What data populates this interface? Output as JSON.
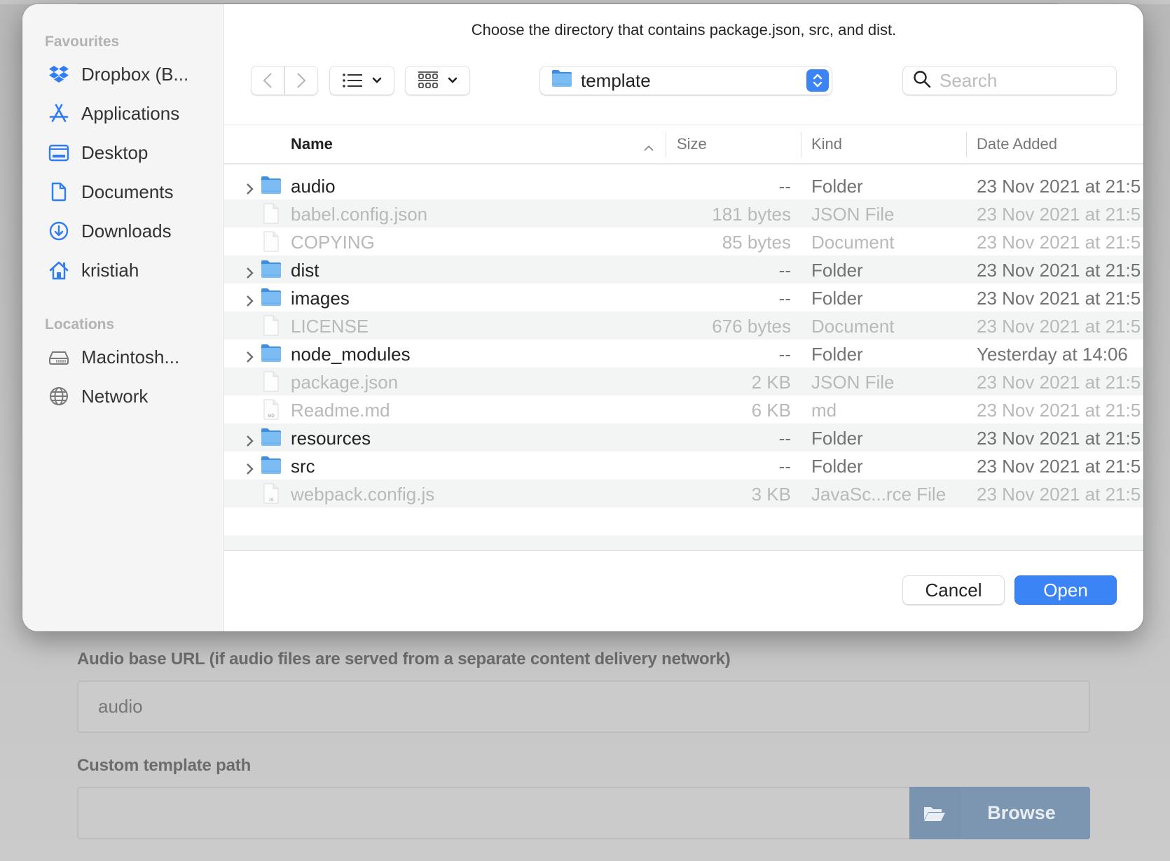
{
  "background": {
    "audio_base_label": "Audio base URL (if audio files are served from a separate content delivery network)",
    "audio_base_value": "audio",
    "custom_template_label": "Custom template path",
    "custom_template_value": "",
    "browse_label": "Browse"
  },
  "dialog": {
    "prompt": "Choose the directory that contains package.json, src, and dist.",
    "sidebar": {
      "favourites_heading": "Favourites",
      "favourites": [
        {
          "label": "Dropbox (B...",
          "icon": "dropbox-icon"
        },
        {
          "label": "Applications",
          "icon": "applications-icon"
        },
        {
          "label": "Desktop",
          "icon": "desktop-icon"
        },
        {
          "label": "Documents",
          "icon": "documents-icon"
        },
        {
          "label": "Downloads",
          "icon": "downloads-icon"
        },
        {
          "label": "kristiah",
          "icon": "home-icon"
        }
      ],
      "locations_heading": "Locations",
      "locations": [
        {
          "label": "Macintosh...",
          "icon": "hard-drive-icon"
        },
        {
          "label": "Network",
          "icon": "network-globe-icon"
        }
      ]
    },
    "toolbar": {
      "current_folder": "template",
      "search_placeholder": "Search",
      "search_value": ""
    },
    "columns": {
      "name": "Name",
      "size": "Size",
      "kind": "Kind",
      "date_added": "Date Added",
      "sort_direction": "ascending"
    },
    "files": [
      {
        "name": "audio",
        "size": "--",
        "kind": "Folder",
        "date": "23 Nov 2021 at 21:5",
        "type": "folder",
        "enabled": true
      },
      {
        "name": "babel.config.json",
        "size": "181 bytes",
        "kind": "JSON File",
        "date": "23 Nov 2021 at 21:5",
        "type": "file",
        "enabled": false
      },
      {
        "name": "COPYING",
        "size": "85 bytes",
        "kind": "Document",
        "date": "23 Nov 2021 at 21:5",
        "type": "file",
        "enabled": false
      },
      {
        "name": "dist",
        "size": "--",
        "kind": "Folder",
        "date": "23 Nov 2021 at 21:5",
        "type": "folder",
        "enabled": true
      },
      {
        "name": "images",
        "size": "--",
        "kind": "Folder",
        "date": "23 Nov 2021 at 21:5",
        "type": "folder",
        "enabled": true
      },
      {
        "name": "LICENSE",
        "size": "676 bytes",
        "kind": "Document",
        "date": "23 Nov 2021 at 21:5",
        "type": "file",
        "enabled": false
      },
      {
        "name": "node_modules",
        "size": "--",
        "kind": "Folder",
        "date": "Yesterday at 14:06",
        "type": "folder",
        "enabled": true
      },
      {
        "name": "package.json",
        "size": "2 KB",
        "kind": "JSON File",
        "date": "23 Nov 2021 at 21:5",
        "type": "file",
        "enabled": false
      },
      {
        "name": "Readme.md",
        "size": "6 KB",
        "kind": "md",
        "date": "23 Nov 2021 at 21:5",
        "type": "file-md",
        "enabled": false
      },
      {
        "name": "resources",
        "size": "--",
        "kind": "Folder",
        "date": "23 Nov 2021 at 21:5",
        "type": "folder",
        "enabled": true
      },
      {
        "name": "src",
        "size": "--",
        "kind": "Folder",
        "date": "23 Nov 2021 at 21:5",
        "type": "folder",
        "enabled": true
      },
      {
        "name": "webpack.config.js",
        "size": "3 KB",
        "kind": "JavaSc...rce File",
        "date": "23 Nov 2021 at 21:5",
        "type": "file-js",
        "enabled": false
      }
    ],
    "buttons": {
      "cancel": "Cancel",
      "open": "Open"
    }
  },
  "colors": {
    "accent": "#3b84f5",
    "sidebar_icon": "#2f7cf6",
    "browse_button": "#7c95b1"
  }
}
